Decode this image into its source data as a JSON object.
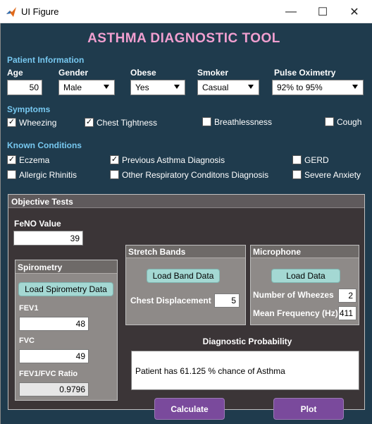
{
  "window": {
    "title": "UI Figure",
    "minimize_glyph": "—",
    "maximize_glyph": "☐",
    "close_glyph": "✕"
  },
  "app_title": "ASTHMA DIAGNOSTIC TOOL",
  "patient": {
    "heading": "Patient Information",
    "age_label": "Age",
    "age_value": "50",
    "gender_label": "Gender",
    "gender_value": "Male",
    "obese_label": "Obese",
    "obese_value": "Yes",
    "smoker_label": "Smoker",
    "smoker_value": "Casual",
    "pulse_label": "Pulse Oximetry",
    "pulse_value": "92% to 95%"
  },
  "symptoms": {
    "heading": "Symptoms",
    "items": [
      {
        "label": "Wheezing",
        "checked": true,
        "check": "✓"
      },
      {
        "label": "Chest Tightness",
        "checked": true,
        "check": "✓"
      },
      {
        "label": "Breathlessness",
        "checked": false,
        "check": ""
      },
      {
        "label": "Cough",
        "checked": false,
        "check": ""
      }
    ]
  },
  "conditions": {
    "heading": "Known Conditions",
    "items": [
      {
        "label": "Eczema",
        "checked": true,
        "check": "✓"
      },
      {
        "label": "Previous Asthma Diagnosis",
        "checked": true,
        "check": "✓"
      },
      {
        "label": "GERD",
        "checked": false,
        "check": ""
      },
      {
        "label": "Allergic Rhinitis",
        "checked": false,
        "check": ""
      },
      {
        "label": "Other Respiratory Conditons Diagnosis",
        "checked": false,
        "check": ""
      },
      {
        "label": "Severe Anxiety",
        "checked": false,
        "check": ""
      }
    ]
  },
  "objective": {
    "title": "Objective Tests",
    "feno_label": "FeNO Value",
    "feno_value": "39",
    "spirometry": {
      "title": "Spirometry",
      "load_button": "Load Spirometry Data",
      "fev1_label": "FEV1",
      "fev1_value": "48",
      "fvc_label": "FVC",
      "fvc_value": "49",
      "ratio_label": "FEV1/FVC Ratio",
      "ratio_value": "0.9796"
    },
    "stretch": {
      "title": "Stretch Bands",
      "load_button": "Load Band Data",
      "chest_label": "Chest Displacement",
      "chest_value": "5"
    },
    "microphone": {
      "title": "Microphone",
      "load_button": "Load Data",
      "wheezes_label": "Number of Wheezes",
      "wheezes_value": "2",
      "freq_label": "Mean Frequency (Hz)",
      "freq_value": "411"
    },
    "diagnostic": {
      "title": "Diagnostic Probability",
      "result": "Patient has 61.125 % chance of Asthma"
    },
    "calculate_button": "Calculate",
    "plot_button": "Plot"
  },
  "colors": {
    "background": "#1f3b4d",
    "title_pink": "#f19fd0",
    "section_blue": "#77c8f0",
    "panel_gray": "#8e8a88",
    "button_cyan": "#a4d8d3",
    "button_purple": "#7a4a9c"
  },
  "icons": {
    "app_icon": "matlab-icon"
  }
}
